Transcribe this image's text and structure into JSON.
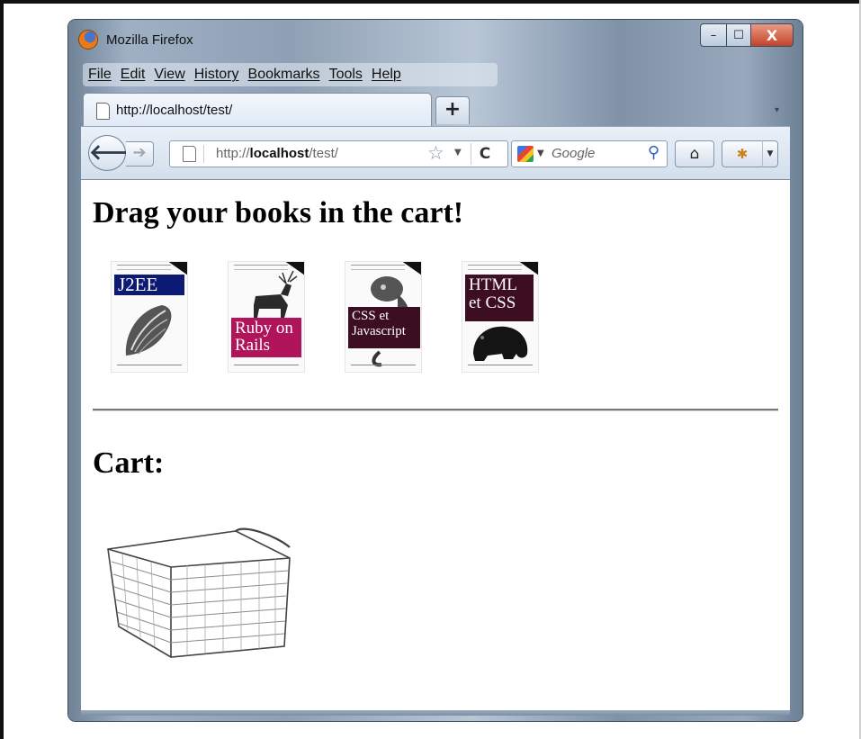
{
  "window": {
    "title": "Mozilla Firefox",
    "controls": {
      "minimize": "–",
      "maximize": "☐",
      "close": "X"
    }
  },
  "menu": [
    "File",
    "Edit",
    "View",
    "History",
    "Bookmarks",
    "Tools",
    "Help"
  ],
  "tab": {
    "label": "http://localhost/test/",
    "new_tab": "+"
  },
  "navigation": {
    "url_prefix": "http://",
    "url_host": "localhost",
    "url_path": "/test/",
    "search_placeholder": "Google"
  },
  "page": {
    "heading": "Drag your books in the cart!",
    "cart_heading": "Cart:",
    "books": [
      {
        "title": "J2EE",
        "band_color": "#0d1a73"
      },
      {
        "title": "Ruby on Rails",
        "band_color": "#b0145a"
      },
      {
        "title": "CSS et Javascript",
        "band_color": "#3d0d22"
      },
      {
        "title": "HTML et CSS",
        "band_color": "#3d0d22"
      }
    ]
  },
  "icons": [
    "firefox-logo",
    "back-arrow",
    "forward-arrow",
    "page",
    "star",
    "reload",
    "google",
    "search-magnifier",
    "home",
    "addon"
  ]
}
